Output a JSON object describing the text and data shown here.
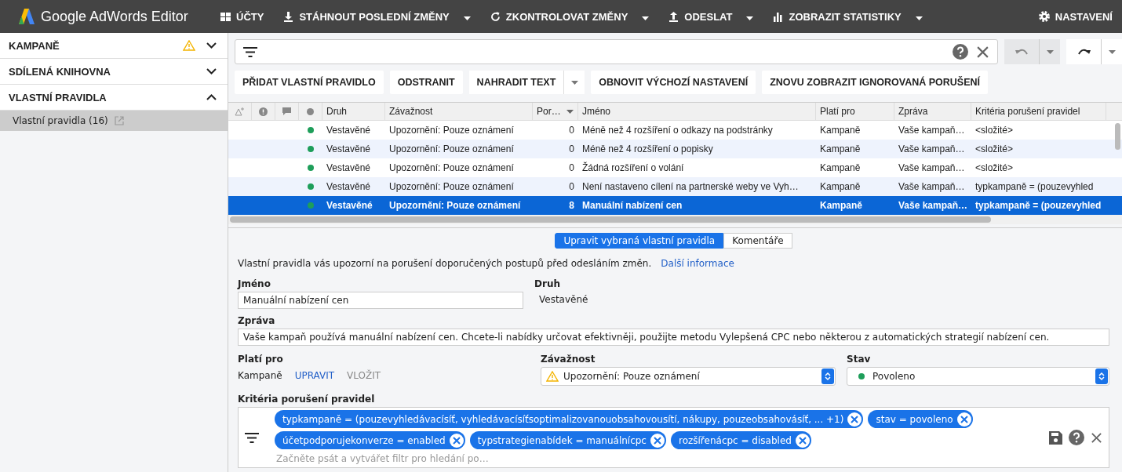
{
  "app": {
    "title": "Google AdWords Editor"
  },
  "toolbar": [
    {
      "label": "ÚČTY",
      "kind": "grid",
      "dropdown": false
    },
    {
      "label": "STÁHNOUT POSLEDNÍ ZMĚNY",
      "kind": "download",
      "dropdown": true
    },
    {
      "label": "ZKONTROLOVAT ZMĚNY",
      "kind": "refresh",
      "dropdown": true
    },
    {
      "label": "ODESLAT",
      "kind": "upload",
      "dropdown": true
    },
    {
      "label": "ZOBRAZIT STATISTIKY",
      "kind": "chart",
      "dropdown": true
    }
  ],
  "settings": {
    "label": "NASTAVENÍ"
  },
  "sidebar": {
    "sections": [
      {
        "label": "KAMPANĚ",
        "warning": true,
        "expanded": false
      },
      {
        "label": "SDÍLENÁ KNIHOVNA",
        "warning": false,
        "expanded": false
      },
      {
        "label": "VLASTNÍ PRAVIDLA",
        "warning": false,
        "expanded": true,
        "children": [
          {
            "label": "Vlastní pravidla (16)",
            "selected": true
          }
        ]
      }
    ]
  },
  "buttons": [
    {
      "label": "PŘIDAT VLASTNÍ PRAVIDLO",
      "dropdown": false
    },
    {
      "label": "ODSTRANIT",
      "dropdown": false
    },
    {
      "label": "NAHRADIT TEXT",
      "dropdown": true
    },
    {
      "label": "OBNOVIT VÝCHOZÍ NASTAVENÍ",
      "dropdown": false
    },
    {
      "label": "ZNOVU ZOBRAZIT IGNOROVANÁ PORUŠENÍ",
      "dropdown": false
    }
  ],
  "table": {
    "columns": [
      {
        "label": "Druh",
        "sorted": false
      },
      {
        "label": "Závažnost",
        "sorted": false
      },
      {
        "label": "Por…",
        "sorted": true
      },
      {
        "label": "Jméno",
        "sorted": false
      },
      {
        "label": "Platí pro",
        "sorted": false
      },
      {
        "label": "Zpráva",
        "sorted": false
      },
      {
        "label": "Kritéria porušení pravidel",
        "sorted": false
      }
    ],
    "rows": [
      {
        "color": "#1e9e5a",
        "selected": false,
        "cells": [
          "Vestavěné",
          "Upozornění: Pouze oznámení",
          "0",
          "Méně než 4 rozšíření o odkazy na podstránky",
          "Kampaně",
          "Vaše kampaň…",
          "<složité>"
        ]
      },
      {
        "color": "#1e9e5a",
        "selected": false,
        "cells": [
          "Vestavěné",
          "Upozornění: Pouze oznámení",
          "0",
          "Méně než 4 rozšíření o popisky",
          "Kampaně",
          "Vaše kampaň…",
          "<složité>"
        ]
      },
      {
        "color": "#1e9e5a",
        "selected": false,
        "cells": [
          "Vestavěné",
          "Upozornění: Pouze oznámení",
          "0",
          "Žádná rozšíření o volání",
          "Kampaně",
          "Vaše kampaň…",
          "<složité>"
        ]
      },
      {
        "color": "#1e9e5a",
        "selected": false,
        "cells": [
          "Vestavěné",
          "Upozornění: Pouze oznámení",
          "0",
          "Není nastaveno cílení na partnerské weby ve Vyh…",
          "Kampaně",
          "Vaše kampaň…",
          "typkampaně = (pouzevyhled"
        ]
      },
      {
        "color": "#1e9e5a",
        "selected": true,
        "cells": [
          "Vestavěné",
          "Upozornění: Pouze oznámení",
          "8",
          "Manuální nabízení cen",
          "Kampaně",
          "Vaše kampaň…",
          "typkampaně = (pouzevyhled"
        ]
      }
    ]
  },
  "detail": {
    "tabs": [
      {
        "label": "Upravit vybraná vlastní pravidla",
        "selected": true
      },
      {
        "label": "Komentáře",
        "selected": false
      }
    ],
    "info": "Vlastní pravidla vás upozorní na porušení doporučených postupů před odesláním změn.",
    "info_link": "Další informace",
    "name": {
      "label": "Jméno",
      "value": "Manuální nabízení cen"
    },
    "type": {
      "label": "Druh",
      "value": "Vestavěné"
    },
    "message": {
      "label": "Zpráva",
      "value": "Vaše kampaň používá manuální nabízení cen. Chcete-li nabídky určovat efektivněji, použijte metodu Vylepšená CPC nebo některou z automatických strategií nabízení cen."
    },
    "applies": {
      "label": "Platí pro",
      "value": "Kampaně",
      "actions": [
        {
          "label": "UPRAVIT",
          "disabled": false
        },
        {
          "label": "VLOŽIT",
          "disabled": true
        }
      ]
    },
    "severity": {
      "label": "Závažnost",
      "value": "Upozornění: Pouze oznámení"
    },
    "status": {
      "label": "Stav",
      "value": "Povoleno",
      "color": "#1e9e5a"
    },
    "criteria": {
      "label": "Kritéria porušení pravidel",
      "chips": [
        "typkampaně = (pouzevyhledávacísíť, vyhledávacísíťsoptimalizovanouobsahovousítí, nákupy, pouzeobsahovásíť, ... +1)",
        "stav = povoleno",
        "účetpodporujekonverze = enabled",
        "typstrategienabídek = manuálnícpc",
        "rozšířenácpc = disabled"
      ],
      "placeholder": "Začněte psát a vytvářet filtr pro hledání po…"
    }
  }
}
